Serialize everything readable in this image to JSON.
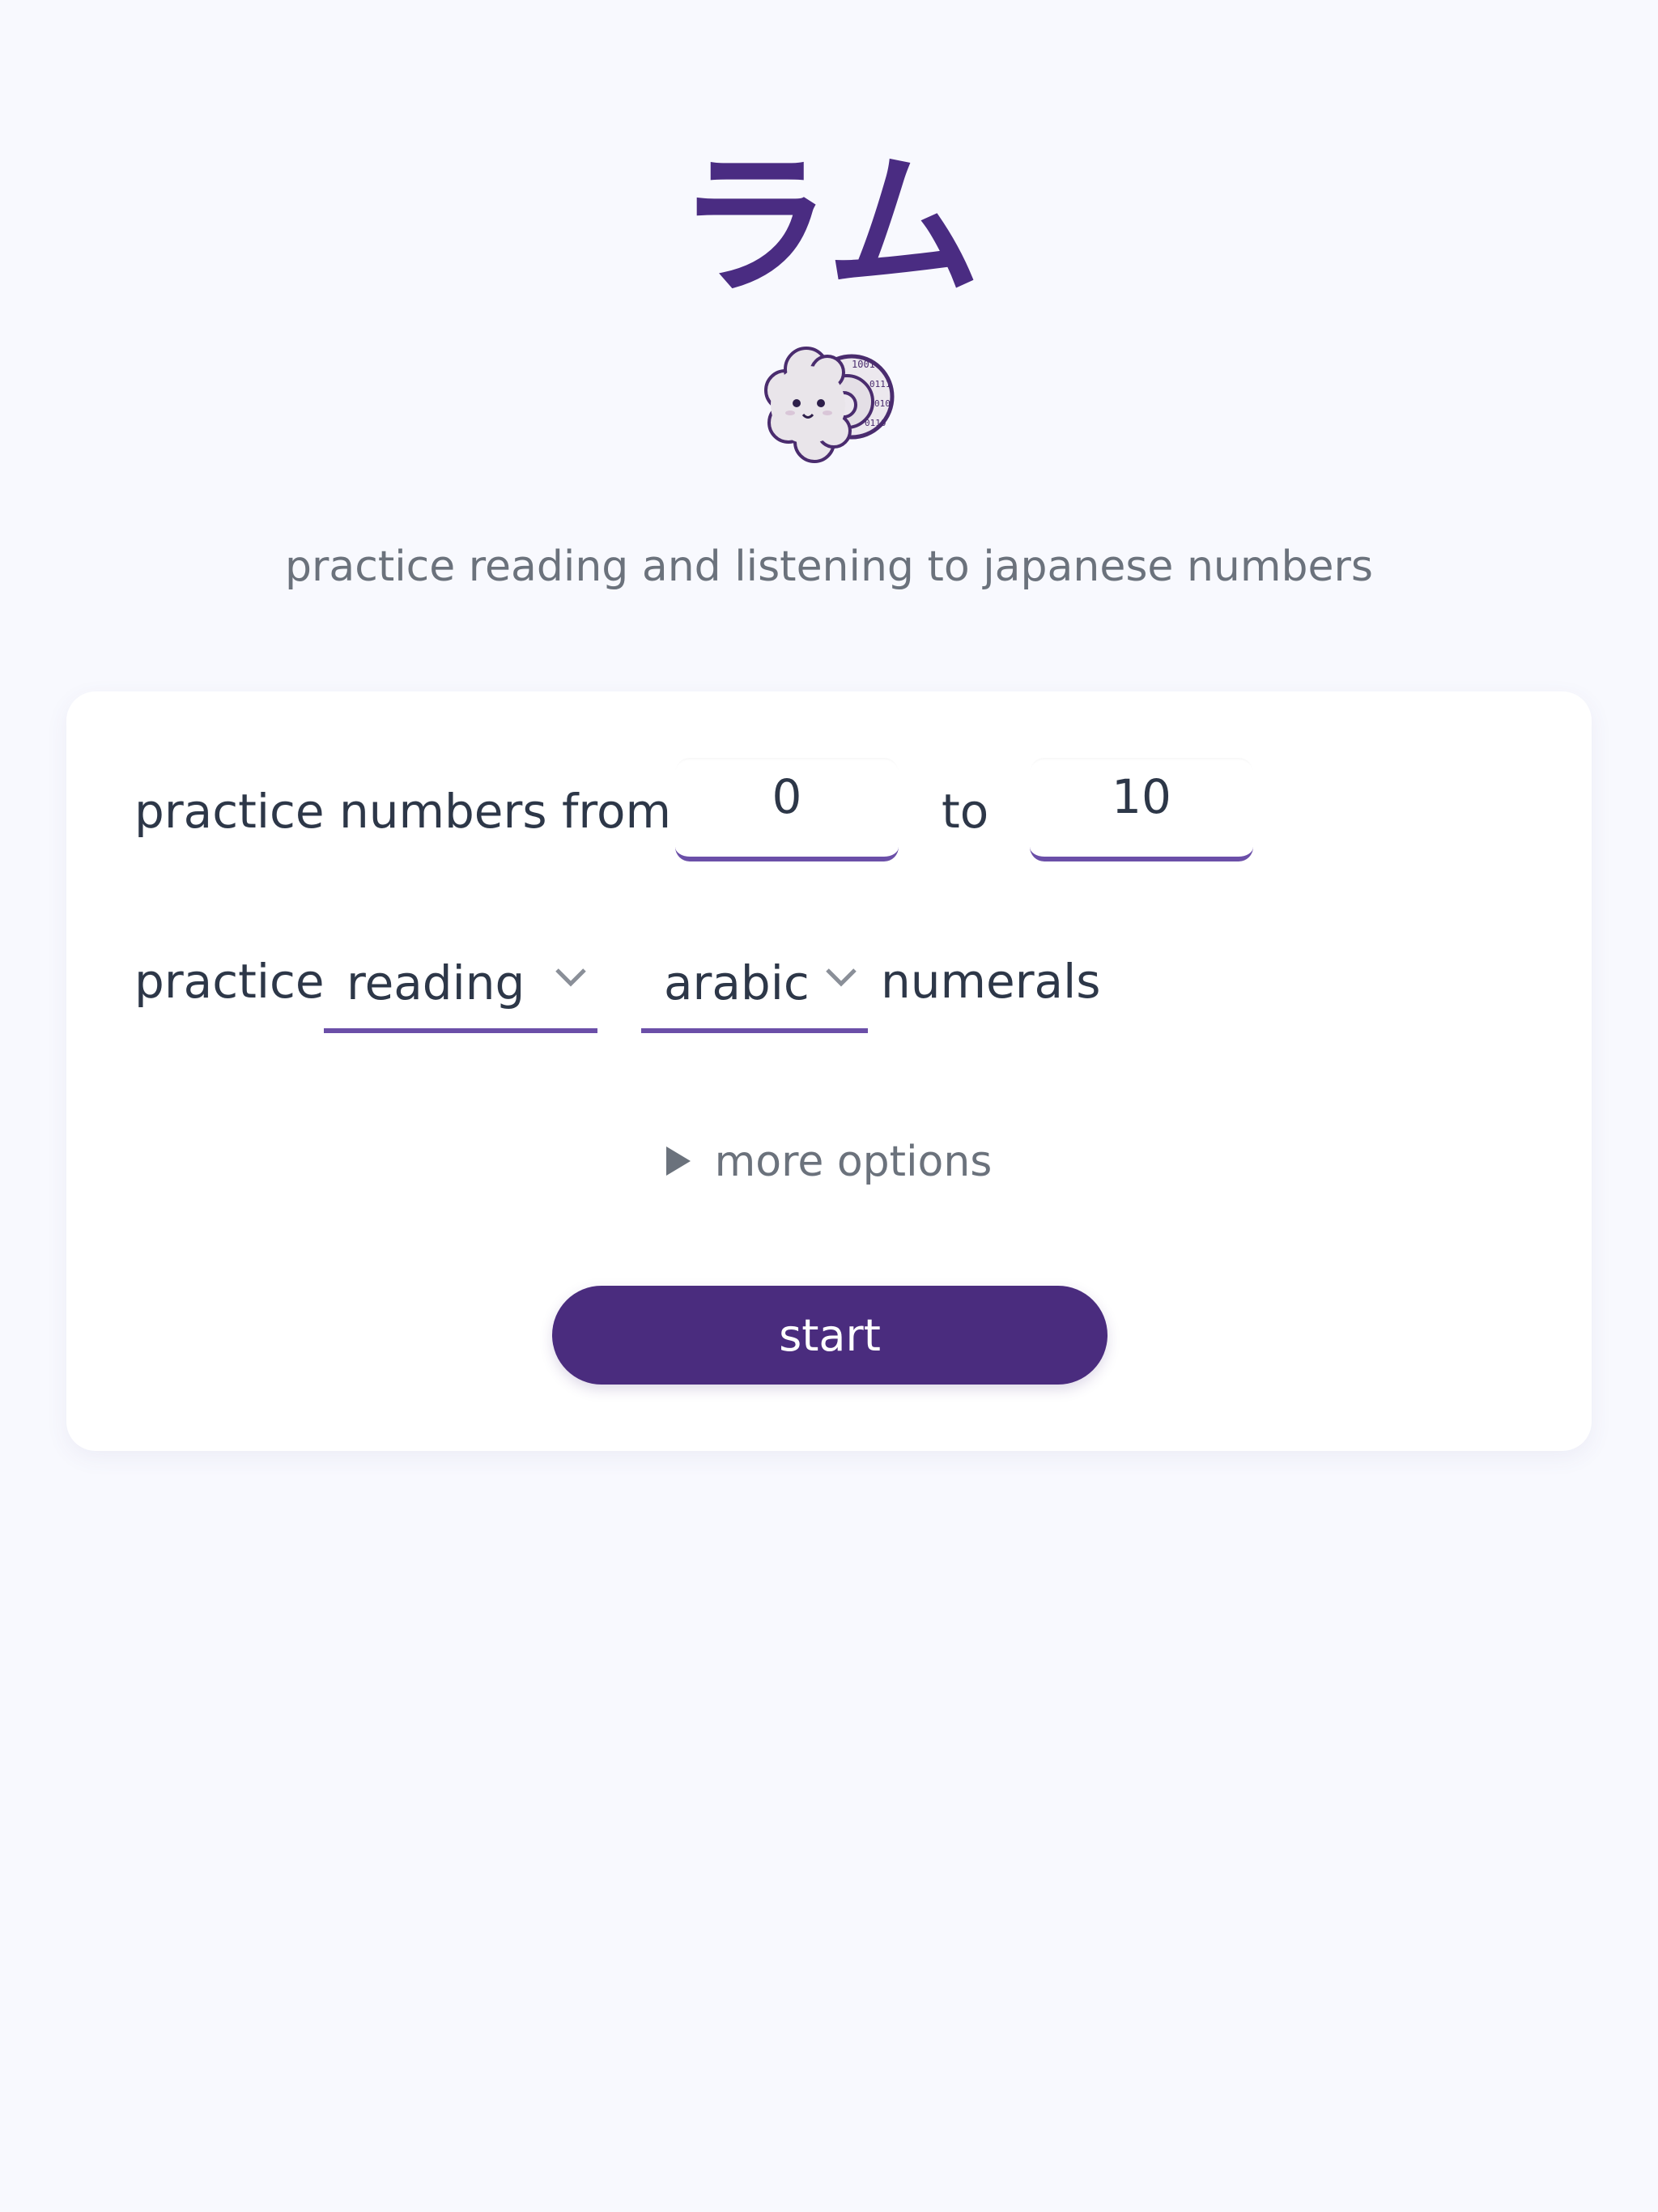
{
  "app": {
    "title": "ラム",
    "subtitle": "practice reading and listening to japanese numbers"
  },
  "range": {
    "prefix_label": "practice numbers from",
    "from_value": "0",
    "to_label": "to",
    "to_value": "10"
  },
  "mode": {
    "prefix_label": "practice",
    "activity_selected": "reading",
    "numeral_type_selected": "arabic",
    "suffix_label": "numerals"
  },
  "more_options_label": "more options",
  "start_label": "start",
  "colors": {
    "accent": "#4a2c82",
    "underline": "#6b4fa8",
    "background": "#f8f9fe",
    "muted_text": "#6b727c"
  },
  "icons": {
    "logo": "ram-logo",
    "dropdown": "chevron-down-icon",
    "expand": "triangle-right-icon"
  }
}
